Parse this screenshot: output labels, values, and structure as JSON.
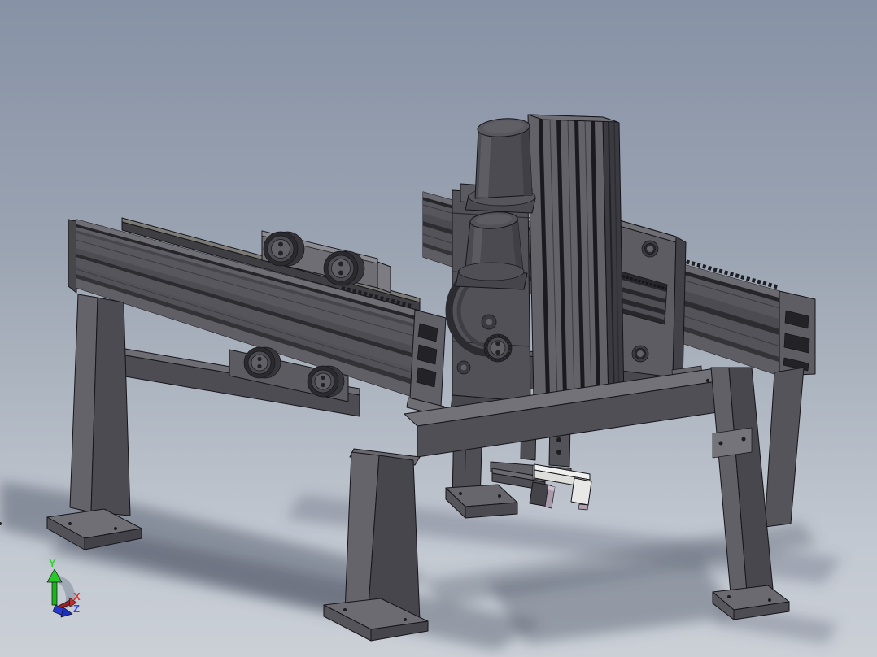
{
  "scene": {
    "type": "3d-cad-viewport",
    "triad": {
      "x_label": "X",
      "y_label": "Y",
      "z_label": "Z",
      "x_color": "#e03030",
      "y_color": "#2fd12f",
      "z_color": "#3347ee"
    },
    "background": {
      "top_color": "#8792a6",
      "mid_color": "#aeb6c1",
      "bottom_color": "#cbd0d7"
    },
    "palette": {
      "part_face": "#55555b",
      "part_side": "#3f3f45",
      "part_top": "#6f6f75",
      "edge_line": "#15151a",
      "groove_dark": "#1b1b1f",
      "wheel_dark": "#2b2b2f",
      "motor_gray": "#4b4b51",
      "jaw_light": "#eceae8",
      "jaw_cut_mauve": "#ab9aab",
      "ground_shadow": "#495162"
    },
    "components": [
      "left-x-rail",
      "right-x-rail",
      "gantry-cross-beam",
      "z-axis-column",
      "z-carriage",
      "upper-drive-motor",
      "lower-drive-motor",
      "left-carriage-roller-plate",
      "roller-wheels",
      "right-carriage-plate",
      "gripper-fork",
      "legs-with-foot-plates",
      "front-stretcher-beam",
      "side-stretcher-beam"
    ]
  }
}
